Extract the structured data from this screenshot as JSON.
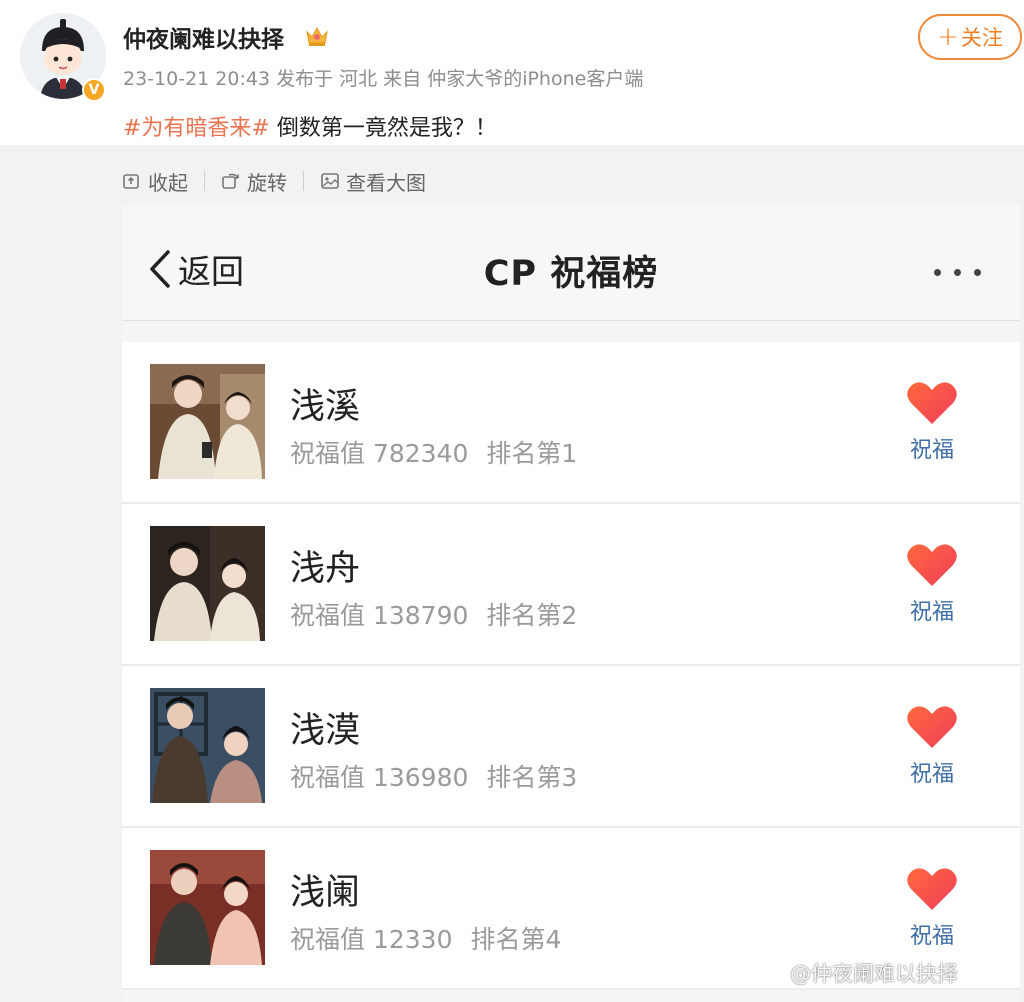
{
  "post": {
    "username": "仲夜阑难以抉择",
    "meta": "23-10-21 20:43  发布于 河北  来自 仲家大爷的iPhone客户端",
    "follow_plus": "+",
    "follow_label": "关注",
    "topic": "#为有暗香来#",
    "text": " 倒数第一竟然是我？！",
    "verified_badge": "V"
  },
  "toolbar": {
    "collapse": "收起",
    "rotate": "旋转",
    "view_large": "查看大图"
  },
  "screenshot": {
    "back_label": "返回",
    "title": "CP 祝福榜",
    "rows": [
      {
        "name": "浅溪",
        "value_label": "祝福值",
        "value": "782340",
        "rank_label": "排名第",
        "rank": "1",
        "action": "祝福"
      },
      {
        "name": "浅舟",
        "value_label": "祝福值",
        "value": "138790",
        "rank_label": "排名第",
        "rank": "2",
        "action": "祝福"
      },
      {
        "name": "浅漠",
        "value_label": "祝福值",
        "value": "136980",
        "rank_label": "排名第",
        "rank": "3",
        "action": "祝福"
      },
      {
        "name": "浅阑",
        "value_label": "祝福值",
        "value": "12330",
        "rank_label": "排名第",
        "rank": "4",
        "action": "祝福"
      }
    ]
  },
  "watermark": "@仲夜阑难以抉择",
  "colors": {
    "accent_orange": "#f07f24",
    "topic": "#eb7350",
    "bless_blue": "#3f6fa6",
    "heart": "#f24a56"
  }
}
